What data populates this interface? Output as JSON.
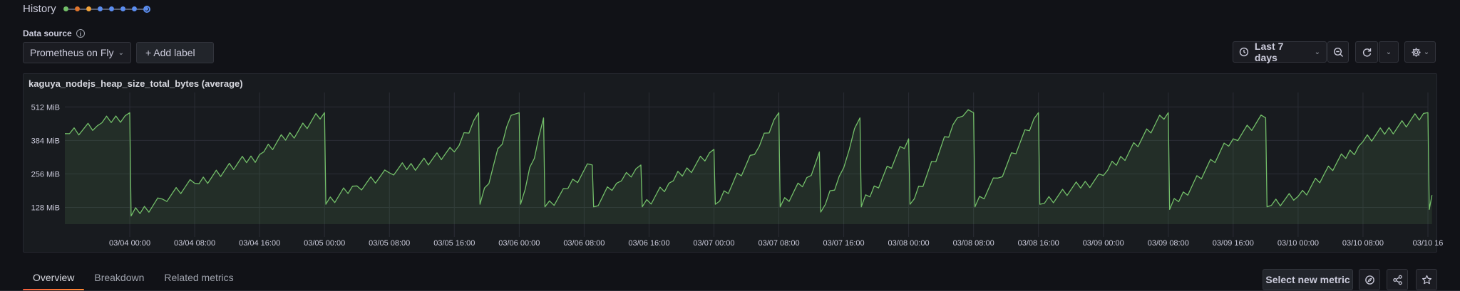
{
  "history": {
    "label": "History",
    "dot_colors": [
      "#73bf69",
      "#e0752d",
      "#f2a33a",
      "#5b8def",
      "#5b8def",
      "#5b8def",
      "#5b8def"
    ]
  },
  "datasource": {
    "label": "Data source",
    "selected": "Prometheus on Fly",
    "add_label_button": "+ Add label"
  },
  "toolbar": {
    "time_range": "Last 7 days"
  },
  "panel": {
    "title": "kaguya_nodejs_heap_size_total_bytes (average)"
  },
  "tabs": [
    "Overview",
    "Breakdown",
    "Related metrics"
  ],
  "actions": {
    "select_new_metric": "Select new metric"
  },
  "colors": {
    "series": "#73bf69",
    "accent_tab": "#f05a28"
  },
  "chart_data": {
    "type": "area",
    "title": "kaguya_nodejs_heap_size_total_bytes (average)",
    "y_unit": "MiB",
    "yticks": [
      "512 MiB",
      "384 MiB",
      "256 MiB",
      "128 MiB"
    ],
    "ytick_values": [
      512,
      384,
      256,
      128
    ],
    "ylim": [
      64,
      540
    ],
    "xlim": [
      "03/03 16:00",
      "03/10 16:00"
    ],
    "xticks": [
      "03/04 00:00",
      "03/04 08:00",
      "03/04 16:00",
      "03/05 00:00",
      "03/05 08:00",
      "03/05 16:00",
      "03/06 00:00",
      "03/06 08:00",
      "03/06 16:00",
      "03/07 00:00",
      "03/07 08:00",
      "03/07 16:00",
      "03/08 00:00",
      "03/08 08:00",
      "03/08 16:00",
      "03/09 00:00",
      "03/09 08:00",
      "03/09 16:00",
      "03/10 00:00",
      "03/10 08:00",
      "03/10 16"
    ],
    "grid": true,
    "legend": "none",
    "series": [
      {
        "points": [
          [
            "03/03 16:00",
            410
          ],
          [
            "03/03 20:00",
            440
          ],
          [
            "03/04 00:00",
            490
          ],
          [
            "03/04 00:10",
            95
          ],
          [
            "03/04 04:00",
            160
          ],
          [
            "03/04 08:00",
            220
          ],
          [
            "03/04 16:00",
            330
          ],
          [
            "03/05 00:00",
            490
          ],
          [
            "03/05 00:10",
            140
          ],
          [
            "03/05 04:00",
            210
          ],
          [
            "03/05 08:00",
            260
          ],
          [
            "03/05 16:00",
            340
          ],
          [
            "03/05 19:00",
            490
          ],
          [
            "03/05 19:10",
            140
          ],
          [
            "03/05 23:00",
            480
          ],
          [
            "03/06 00:00",
            490
          ],
          [
            "03/06 00:10",
            140
          ],
          [
            "03/06 03:00",
            470
          ],
          [
            "03/06 03:10",
            130
          ],
          [
            "03/06 06:00",
            200
          ],
          [
            "03/06 09:00",
            290
          ],
          [
            "03/06 09:10",
            130
          ],
          [
            "03/06 12:00",
            220
          ],
          [
            "03/06 15:00",
            290
          ],
          [
            "03/06 15:10",
            130
          ],
          [
            "03/06 19:00",
            230
          ],
          [
            "03/07 00:00",
            350
          ],
          [
            "03/07 00:10",
            140
          ],
          [
            "03/07 05:00",
            330
          ],
          [
            "03/07 08:00",
            490
          ],
          [
            "03/07 08:10",
            130
          ],
          [
            "03/07 12:00",
            250
          ],
          [
            "03/07 13:00",
            340
          ],
          [
            "03/07 13:10",
            110
          ],
          [
            "03/07 16:00",
            280
          ],
          [
            "03/07 18:00",
            470
          ],
          [
            "03/07 18:10",
            130
          ],
          [
            "03/08 00:00",
            390
          ],
          [
            "03/08 00:10",
            140
          ],
          [
            "03/08 06:00",
            470
          ],
          [
            "03/08 08:00",
            490
          ],
          [
            "03/08 08:10",
            130
          ],
          [
            "03/08 11:00",
            240
          ],
          [
            "03/08 16:00",
            490
          ],
          [
            "03/08 16:10",
            140
          ],
          [
            "03/09 00:00",
            250
          ],
          [
            "03/09 08:00",
            490
          ],
          [
            "03/09 08:10",
            120
          ],
          [
            "03/09 16:00",
            390
          ],
          [
            "03/09 20:00",
            470
          ],
          [
            "03/09 20:10",
            130
          ],
          [
            "03/10 00:00",
            170
          ],
          [
            "03/10 08:00",
            380
          ],
          [
            "03/10 16:00",
            490
          ],
          [
            "03/10 16:10",
            120
          ],
          [
            "03/10 16:30",
            175
          ]
        ]
      }
    ]
  }
}
